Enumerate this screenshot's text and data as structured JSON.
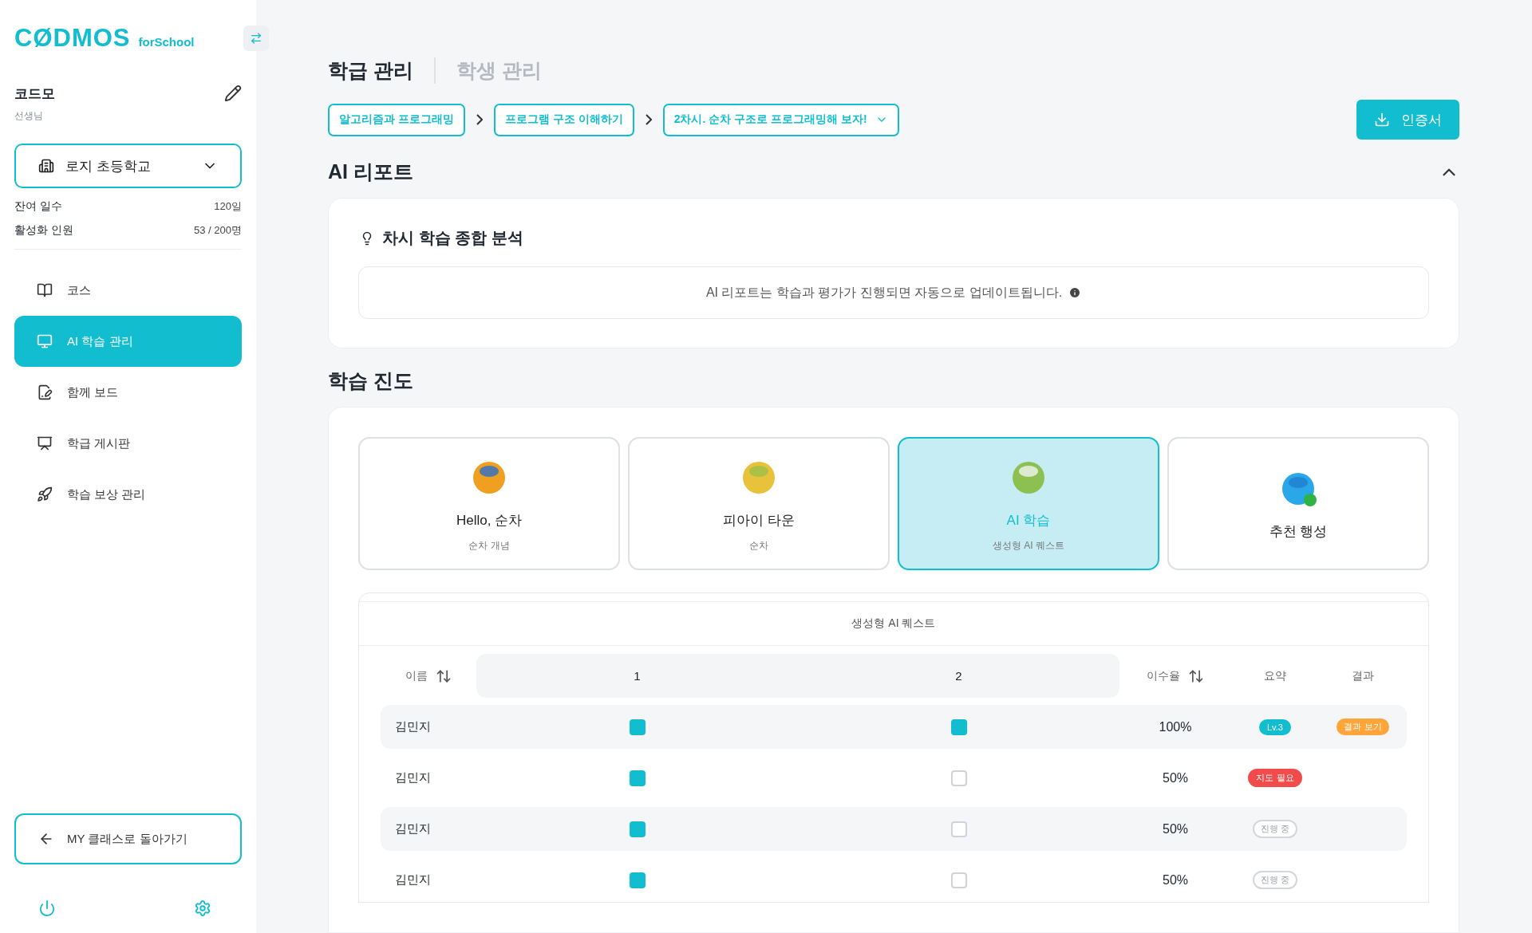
{
  "sidebar": {
    "logo": "CØDMOS",
    "logo_sub": "forSchool",
    "user": {
      "name": "코드모",
      "role": "선생님"
    },
    "school": "로지 초등학교",
    "stats": [
      {
        "label": "잔여 일수",
        "value": "120일"
      },
      {
        "label": "활성화 인원",
        "value": "53 / 200명"
      }
    ],
    "nav": [
      {
        "label": "코스",
        "selected": false
      },
      {
        "label": "AI 학습 관리",
        "selected": true
      },
      {
        "label": "함께 보드",
        "selected": false
      },
      {
        "label": "학급 게시판",
        "selected": false
      },
      {
        "label": "학습 보상 관리",
        "selected": false
      }
    ],
    "back_button": "MY 클래스로 돌아가기"
  },
  "tabs": [
    {
      "label": "학급 관리",
      "selected": true
    },
    {
      "label": "학생 관리",
      "selected": false
    }
  ],
  "breadcrumb": [
    {
      "label": "알고리즘과 프로그래밍",
      "kind": "link"
    },
    {
      "label": "프로그램 구조 이해하기",
      "kind": "link"
    },
    {
      "label": "2차시. 순차 구조로 프로그래밍해 보자!",
      "kind": "dropdown"
    }
  ],
  "certificate_button": "인증서",
  "ai_report": {
    "title": "AI 리포트",
    "expanded": true,
    "card_title": "차시 학습 종합 분석",
    "message": "AI 리포트는 학습과 평가가 진행되면 자동으로 업데이트됩니다."
  },
  "progress": {
    "title": "학습 진도",
    "stages": [
      {
        "title": "Hello, 순차",
        "subtitle": "순차 개념",
        "selected": false
      },
      {
        "title": "피아이 타운",
        "subtitle": "순차",
        "selected": false
      },
      {
        "title": "AI 학습",
        "subtitle": "생성형 AI 퀘스트",
        "selected": true
      },
      {
        "title": "추천 행성",
        "selected": false
      }
    ],
    "table": {
      "title": "생성형 AI 퀘스트",
      "columns": {
        "name": "이름",
        "steps": [
          "1",
          "2"
        ],
        "rate": "이수율",
        "summary": "요약",
        "result": "결과"
      },
      "rows": [
        {
          "name": "김민지",
          "steps": [
            true,
            true
          ],
          "rate": "100%",
          "summary": {
            "label": "Lv.3",
            "kind": "level"
          },
          "result": "결과 보기"
        },
        {
          "name": "김민지",
          "steps": [
            true,
            false
          ],
          "rate": "50%",
          "summary": {
            "label": "지도 필요",
            "kind": "alert"
          }
        },
        {
          "name": "김민지",
          "steps": [
            true,
            false
          ],
          "rate": "50%",
          "summary": {
            "label": "진행 중",
            "kind": "progress"
          }
        },
        {
          "name": "김민지",
          "steps": [
            true,
            false
          ],
          "rate": "50%",
          "summary": {
            "label": "진행 중",
            "kind": "progress"
          }
        }
      ]
    }
  }
}
